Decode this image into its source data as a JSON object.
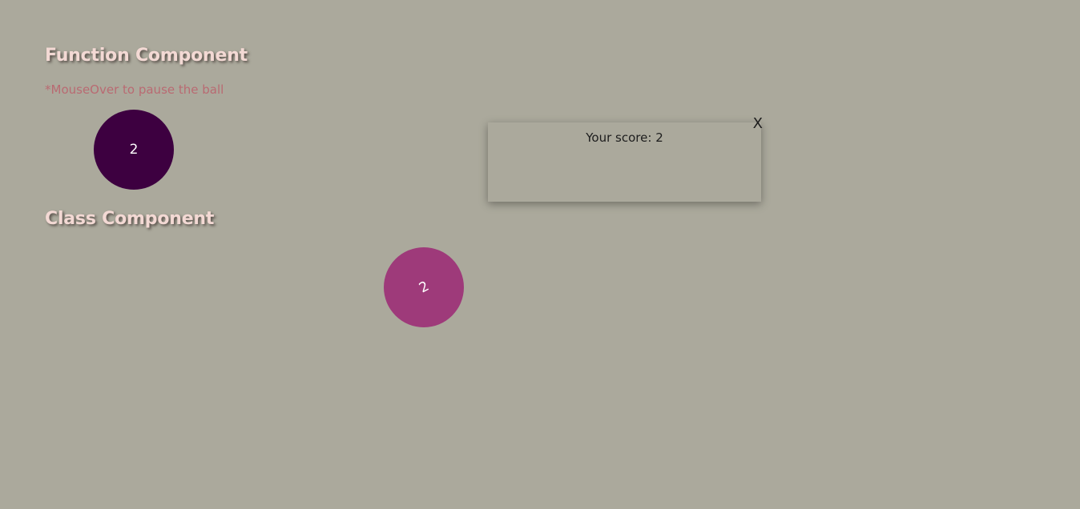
{
  "function_section": {
    "title": "Function Component",
    "hint": "*MouseOver to pause the ball",
    "ball_value": "2"
  },
  "class_section": {
    "title": "Class Component",
    "ball_value": "2"
  },
  "popup": {
    "close_label": "X",
    "score_label": "Your score: ",
    "score_value": "2"
  },
  "colors": {
    "background": "#aba99c",
    "title": "#f3d9d4",
    "hint": "#b96a72",
    "function_ball": "#3d0040",
    "class_ball": "#9e3a7a"
  }
}
